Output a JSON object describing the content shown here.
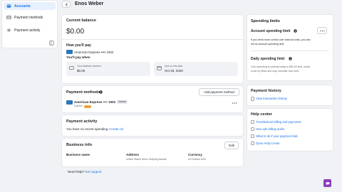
{
  "sidebar": {
    "items": [
      {
        "label": "Accounts",
        "active": true
      },
      {
        "label": "Payment methods",
        "active": false
      },
      {
        "label": "Payment activity",
        "active": false
      }
    ]
  },
  "header": {
    "title": "Enos Weber"
  },
  "current_balance": {
    "title": "Current balance",
    "amount": "$0.00",
    "how_youll_pay": "How you'll pay",
    "card": "American Express •••• 1002",
    "youll_pay_when": "You'll pay when",
    "balance_label": "Your balance reaches",
    "balance_value": "$0.00",
    "date_label": "And on this date",
    "date_value": "Oct 26, 2020"
  },
  "payment_methods": {
    "title": "Payment methods",
    "add_button": "Add payment method",
    "card": "American Express •••• 1002",
    "badge": "Default",
    "expiry": "Expires"
  },
  "payment_activity": {
    "title": "Payment activity",
    "empty_text": "You have no recent spending.",
    "create_ad": "Create Ad"
  },
  "business_info": {
    "title": "Business info",
    "edit_button": "Edit",
    "name_label": "Business name",
    "address_label": "Address",
    "address_value": "United States Minor Outlying Islands",
    "currency_label": "Currency",
    "currency_value": "US Dollars USD"
  },
  "help_footer": {
    "text": "Need help?",
    "link": "Get support"
  },
  "spending_limits": {
    "title": "Spending limits",
    "account_limit_title": "Account spending limit",
    "account_limit_desc_1": "If you need more control over total ad costs, you can",
    "account_limit_desc_2": "set an account spending limit.",
    "daily_limit_title": "Daily spending limit",
    "daily_limit_desc_1": "Your spending is unlikely today is $50.00 limit, which",
    "daily_limit_desc_2": "is set by Meta and may increase over time."
  },
  "payment_history": {
    "title": "Payment history",
    "link": "View transaction history"
  },
  "help_center": {
    "title": "Help center",
    "links": [
      "Troubleshoot billing and payments",
      "How ads billing works",
      "What to do if your payment fails",
      "Open Help Center"
    ]
  },
  "colors": {
    "accent": "#1b74e4",
    "background": "#f0f2f5",
    "chat_button": "#8b3dbd"
  }
}
